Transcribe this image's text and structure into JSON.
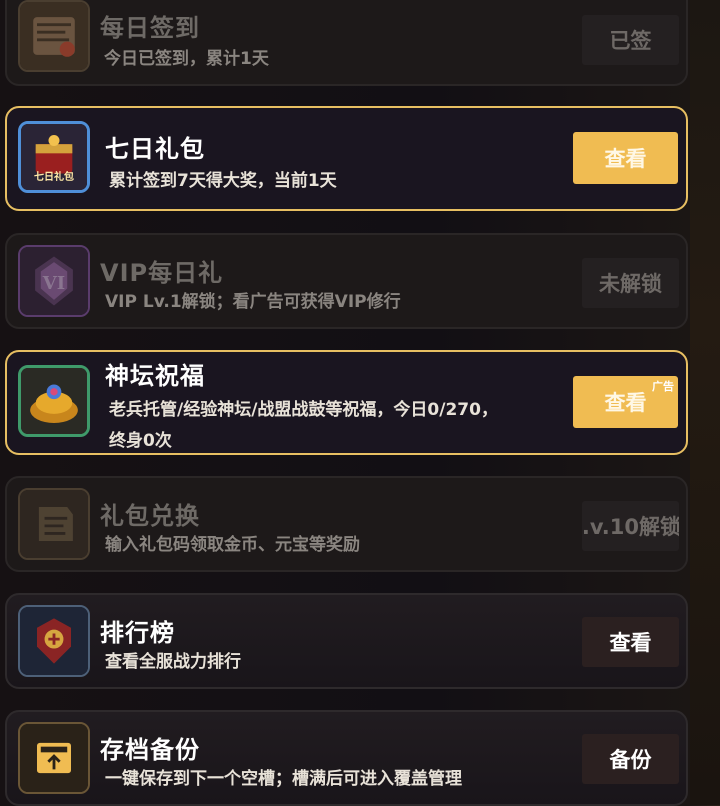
{
  "cards": [
    {
      "title": "每日签到",
      "desc": "今日已签到，累计1天",
      "button": "已签",
      "icon": "scroll-icon"
    },
    {
      "title": "七日礼包",
      "desc": "累计签到7天得大奖，当前1天",
      "button": "查看",
      "icon": "treasure-chest-icon",
      "icon_label": "七日礼包"
    },
    {
      "title": "VIP每日礼",
      "desc": "VIP Lv.1解锁；看广告可获得VIP修行",
      "button": "未解锁",
      "icon": "vip-crest-icon",
      "icon_label": "VI"
    },
    {
      "title": "神坛祝福",
      "desc_line1": "老兵托管/经验神坛/战盟战鼓等祝福，今日0/270，",
      "desc_line2": "终身0次",
      "button": "查看",
      "ad_tag": "广告",
      "icon": "gold-pile-icon"
    },
    {
      "title": "礼包兑换",
      "desc": "输入礼包码领取金币、元宝等奖励",
      "button": ".v.10解锁",
      "icon": "gift-scroll-icon"
    },
    {
      "title": "排行榜",
      "desc": "查看全服战力排行",
      "button": "查看",
      "icon": "ranking-emblem-icon"
    },
    {
      "title": "存档备份",
      "desc": "一键保存到下一个空槽；槽满后可进入覆盖管理",
      "button": "备份",
      "icon": "save-box-icon"
    }
  ],
  "colors": {
    "accent_gold": "#f0bc52",
    "highlight_border": "#e7bf62"
  }
}
